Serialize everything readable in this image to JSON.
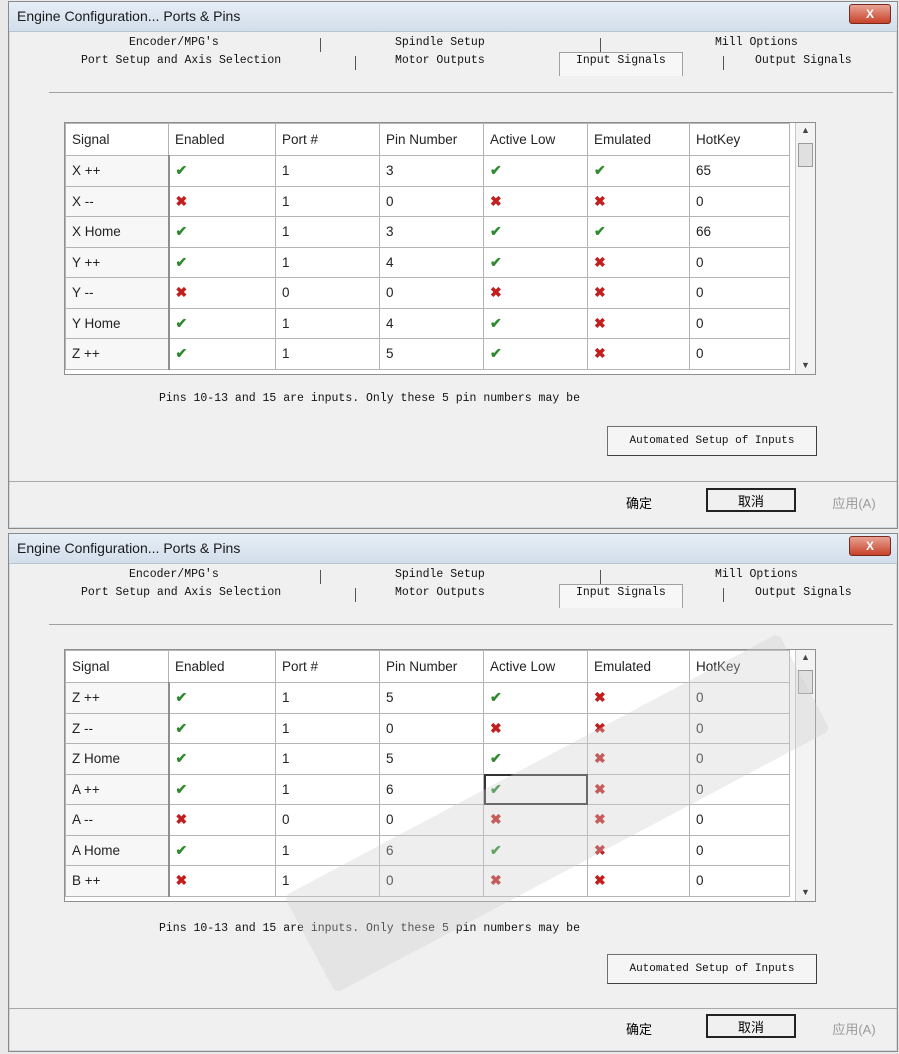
{
  "dialogs": [
    {
      "title": "Engine Configuration... Ports & Pins",
      "close_label": "X",
      "tabs_row1": [
        "Encoder/MPG's",
        "Spindle Setup",
        "Mill Options"
      ],
      "tabs_row2": [
        "Port Setup and Axis Selection",
        "Motor Outputs",
        "Input Signals",
        "Output Signals"
      ],
      "active_tab": "Input Signals",
      "columns": [
        "Signal",
        "Enabled",
        "Port #",
        "Pin Number",
        "Active Low",
        "Emulated",
        "HotKey"
      ],
      "rows": [
        {
          "signal": "X ++",
          "enabled": true,
          "port": "1",
          "pin": "3",
          "active_low": true,
          "emulated": true,
          "hotkey": "65"
        },
        {
          "signal": "X --",
          "enabled": false,
          "port": "1",
          "pin": "0",
          "active_low": false,
          "emulated": false,
          "hotkey": "0"
        },
        {
          "signal": "X Home",
          "enabled": true,
          "port": "1",
          "pin": "3",
          "active_low": true,
          "emulated": true,
          "hotkey": "66"
        },
        {
          "signal": "Y ++",
          "enabled": true,
          "port": "1",
          "pin": "4",
          "active_low": true,
          "emulated": false,
          "hotkey": "0"
        },
        {
          "signal": "Y --",
          "enabled": false,
          "port": "0",
          "pin": "0",
          "active_low": false,
          "emulated": false,
          "hotkey": "0"
        },
        {
          "signal": "Y Home",
          "enabled": true,
          "port": "1",
          "pin": "4",
          "active_low": true,
          "emulated": false,
          "hotkey": "0"
        },
        {
          "signal": "Z ++",
          "enabled": true,
          "port": "1",
          "pin": "5",
          "active_low": true,
          "emulated": false,
          "hotkey": "0"
        }
      ],
      "note": "Pins 10-13 and 15 are inputs. Only these 5 pin numbers may be",
      "auto_button": "Automated Setup of Inputs",
      "ok": "确定",
      "cancel": "取消",
      "apply": "应用(A)"
    },
    {
      "title": "Engine Configuration... Ports & Pins",
      "close_label": "X",
      "tabs_row1": [
        "Encoder/MPG's",
        "Spindle Setup",
        "Mill Options"
      ],
      "tabs_row2": [
        "Port Setup and Axis Selection",
        "Motor Outputs",
        "Input Signals",
        "Output Signals"
      ],
      "active_tab": "Input Signals",
      "columns": [
        "Signal",
        "Enabled",
        "Port #",
        "Pin Number",
        "Active Low",
        "Emulated",
        "HotKey"
      ],
      "rows": [
        {
          "signal": "Z ++",
          "enabled": true,
          "port": "1",
          "pin": "5",
          "active_low": true,
          "emulated": false,
          "hotkey": "0"
        },
        {
          "signal": "Z --",
          "enabled": true,
          "port": "1",
          "pin": "0",
          "active_low": false,
          "emulated": false,
          "hotkey": "0"
        },
        {
          "signal": "Z Home",
          "enabled": true,
          "port": "1",
          "pin": "5",
          "active_low": true,
          "emulated": false,
          "hotkey": "0"
        },
        {
          "signal": "A ++",
          "enabled": true,
          "port": "1",
          "pin": "6",
          "active_low": true,
          "emulated": false,
          "hotkey": "0",
          "selected": true
        },
        {
          "signal": "A --",
          "enabled": false,
          "port": "0",
          "pin": "0",
          "active_low": false,
          "emulated": false,
          "hotkey": "0"
        },
        {
          "signal": "A Home",
          "enabled": true,
          "port": "1",
          "pin": "6",
          "active_low": true,
          "emulated": false,
          "hotkey": "0"
        },
        {
          "signal": "B ++",
          "enabled": false,
          "port": "1",
          "pin": "0",
          "active_low": false,
          "emulated": false,
          "hotkey": "0"
        }
      ],
      "note": "Pins 10-13 and 15 are inputs. Only these 5 pin numbers may be",
      "auto_button": "Automated Setup of Inputs",
      "ok": "确定",
      "cancel": "取消",
      "apply": "应用(A)"
    }
  ],
  "icons": {
    "enabled_mark": "green-check-icon",
    "disabled_mark": "red-x-icon"
  },
  "colors": {
    "check": "#2f8a2f",
    "cross": "#c21e1e",
    "close_button": "#c7422a"
  }
}
